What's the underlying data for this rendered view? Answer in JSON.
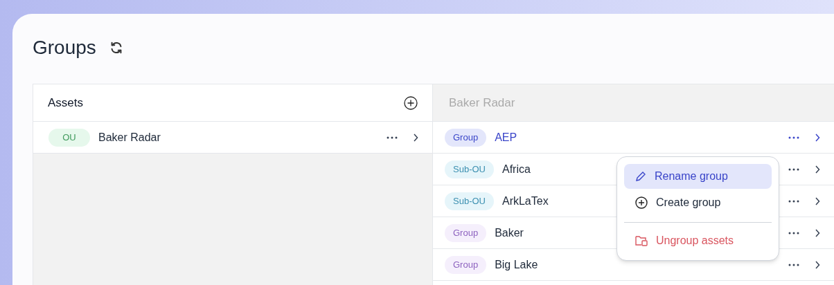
{
  "title": "Groups",
  "assets_panel": {
    "title": "Assets",
    "rows": [
      {
        "tag": "OU",
        "kind": "ou",
        "name": "Baker Radar",
        "selected": false
      }
    ]
  },
  "detail_panel": {
    "title": "Baker Radar",
    "rows": [
      {
        "tag": "Group",
        "kind": "group",
        "name": "AEP",
        "selected": true
      },
      {
        "tag": "Sub-OU",
        "kind": "subou",
        "name": "Africa",
        "selected": false
      },
      {
        "tag": "Sub-OU",
        "kind": "subou",
        "name": "ArkLaTex",
        "selected": false
      },
      {
        "tag": "Group",
        "kind": "group",
        "name": "Baker",
        "selected": false
      },
      {
        "tag": "Group",
        "kind": "group",
        "name": "Big Lake",
        "selected": false
      }
    ]
  },
  "context_menu": {
    "items": [
      {
        "label": "Rename group",
        "kind": "edit",
        "selected": true
      },
      {
        "label": "Create group",
        "kind": "add",
        "selected": false
      },
      {
        "label": "Ungroup assets",
        "kind": "danger",
        "selected": false
      }
    ]
  }
}
